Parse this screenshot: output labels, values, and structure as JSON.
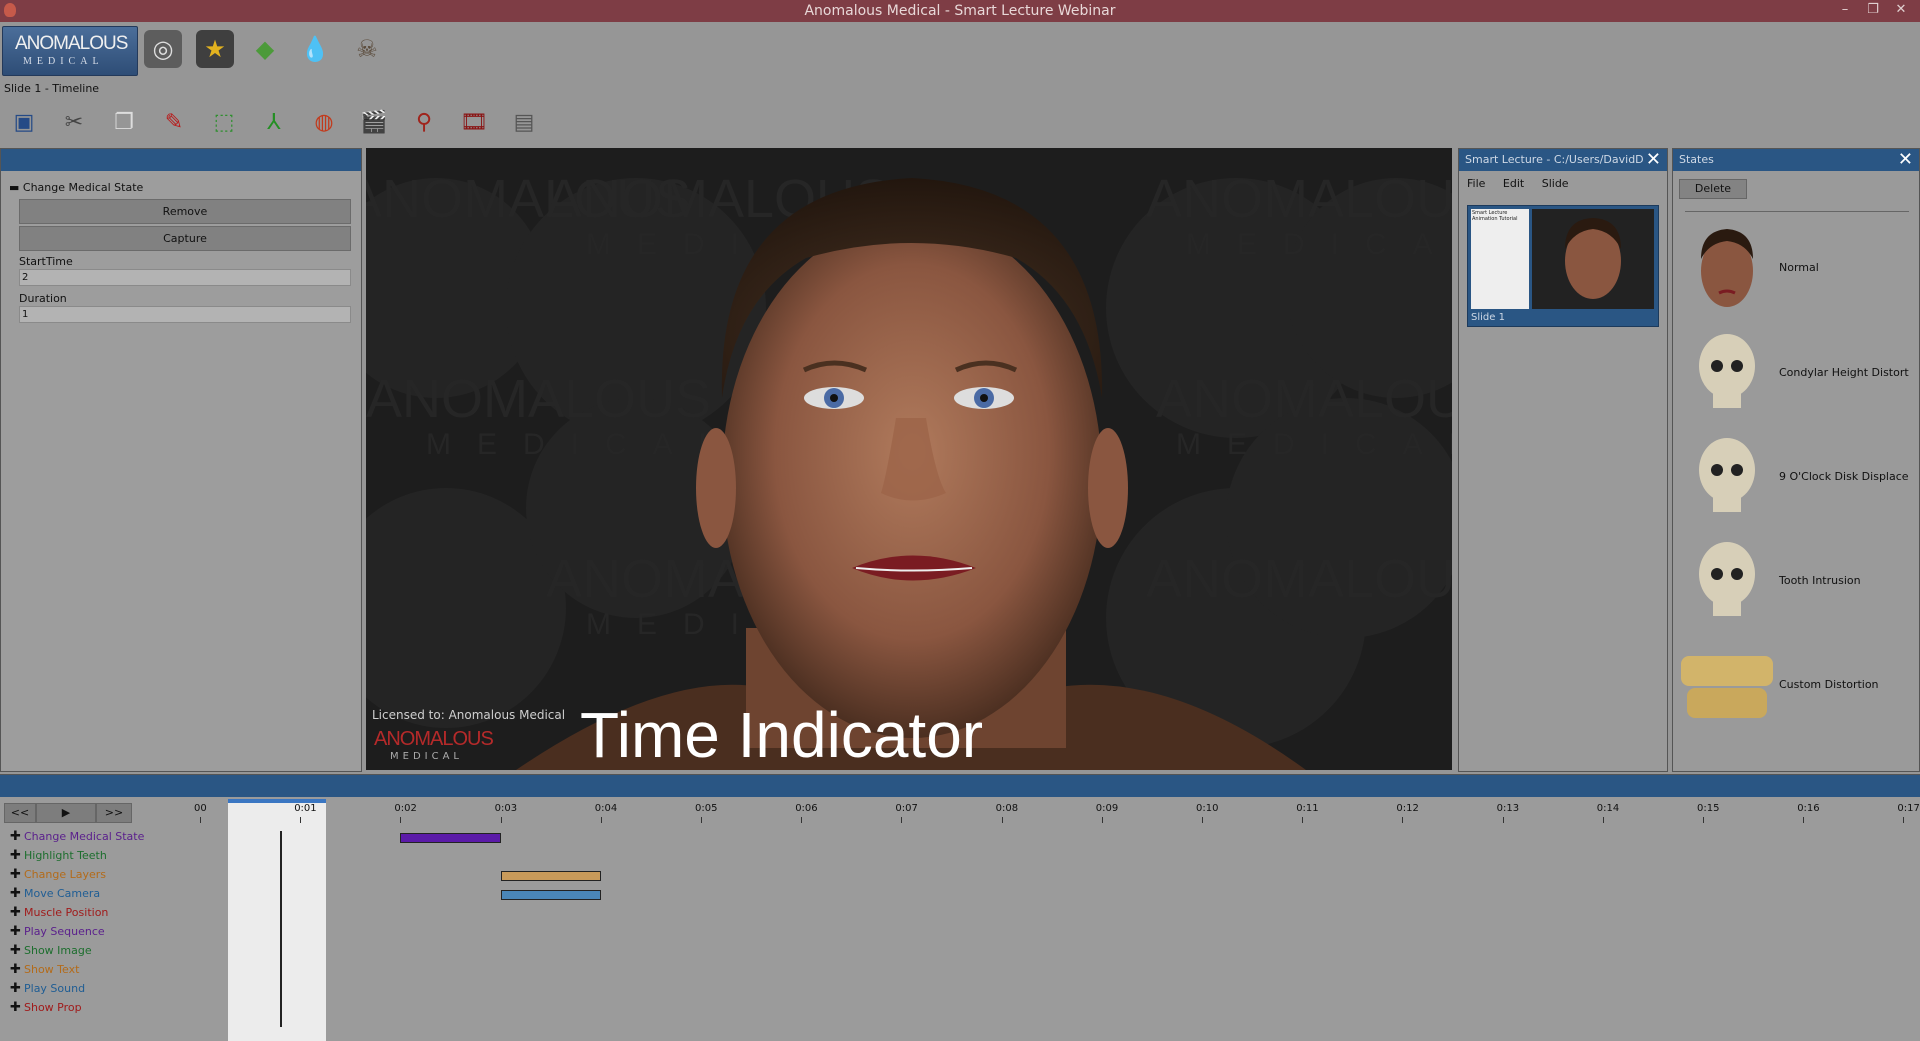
{
  "window": {
    "title": "Anomalous Medical - Smart Lecture  Webinar"
  },
  "logo": {
    "line1": "ANOMALOUS",
    "line2": "MEDICAL"
  },
  "topbar": {
    "icons": [
      "anatomy-tasks-icon",
      "favorites-star-icon",
      "layers-icon",
      "fluid-drop-icon",
      "skull-icon"
    ]
  },
  "slide_label": "Slide 1 - Timeline",
  "toolbar": {
    "icons": [
      "save-icon",
      "cut-icon",
      "copy-icon",
      "eraser-icon",
      "add-selection-icon",
      "axes-icon",
      "color-wheel-icon",
      "clapperboard-icon",
      "marker-icon",
      "film-icon",
      "properties-icon"
    ]
  },
  "properties": {
    "section_title": "Change Medical State",
    "remove_label": "Remove",
    "capture_label": "Capture",
    "start_time_label": "StartTime",
    "start_time_value": "2",
    "duration_label": "Duration",
    "duration_value": "1"
  },
  "viewport": {
    "licensed": "Licensed to:  Anomalous Medical",
    "overlay_caption": "Time Indicator",
    "watermark1": "ANOMALOUS",
    "watermark2": "MEDICAL"
  },
  "smart_lecture": {
    "title": "Smart Lecture - C:/Users/DavidD",
    "menu": [
      "File",
      "Edit",
      "Slide"
    ],
    "slide_label": "Slide 1",
    "thumb_text": "Smart Lecture Animation Tutorial"
  },
  "states": {
    "title": "States",
    "delete_label": "Delete",
    "items": [
      {
        "label": "Normal",
        "icon": "face-icon"
      },
      {
        "label": "Condylar Height Distort",
        "icon": "skull-icon"
      },
      {
        "label": "9 O'Clock Disk Displace",
        "icon": "skull-icon"
      },
      {
        "label": "Tooth Intrusion",
        "icon": "skull-icon"
      },
      {
        "label": "Custom Distortion",
        "icon": "teeth-icon"
      }
    ]
  },
  "timeline": {
    "rewind_label": "<<",
    "play_label": "▶",
    "forward_label": ">>",
    "ticks": [
      "00",
      "0:01",
      "0:02",
      "0:03",
      "0:04",
      "0:05",
      "0:06",
      "0:07",
      "0:08",
      "0:09",
      "0:10",
      "0:11",
      "0:12",
      "0:13",
      "0:14",
      "0:15",
      "0:16",
      "0:17"
    ],
    "tracks": [
      {
        "label": "Change Medical State",
        "color": "#5a1f8c"
      },
      {
        "label": "Highlight Teeth",
        "color": "#1d6e2e"
      },
      {
        "label": "Change Layers",
        "color": "#b36b1a"
      },
      {
        "label": "Move Camera",
        "color": "#1f5d94"
      },
      {
        "label": "Muscle Position",
        "color": "#a01b1b"
      },
      {
        "label": "Play Sequence",
        "color": "#5a1f8c"
      },
      {
        "label": "Show Image",
        "color": "#1d6e2e"
      },
      {
        "label": "Show Text",
        "color": "#b36b1a"
      },
      {
        "label": "Play Sound",
        "color": "#1f5d94"
      },
      {
        "label": "Show Prop",
        "color": "#a01b1b"
      }
    ],
    "events": [
      {
        "track": 0,
        "start": 2,
        "duration": 1,
        "color": "#5b1aa8"
      },
      {
        "track": 2,
        "start": 3,
        "duration": 1,
        "color": "#c89a5a"
      },
      {
        "track": 3,
        "start": 3,
        "duration": 1,
        "color": "#4a86b8"
      }
    ]
  }
}
